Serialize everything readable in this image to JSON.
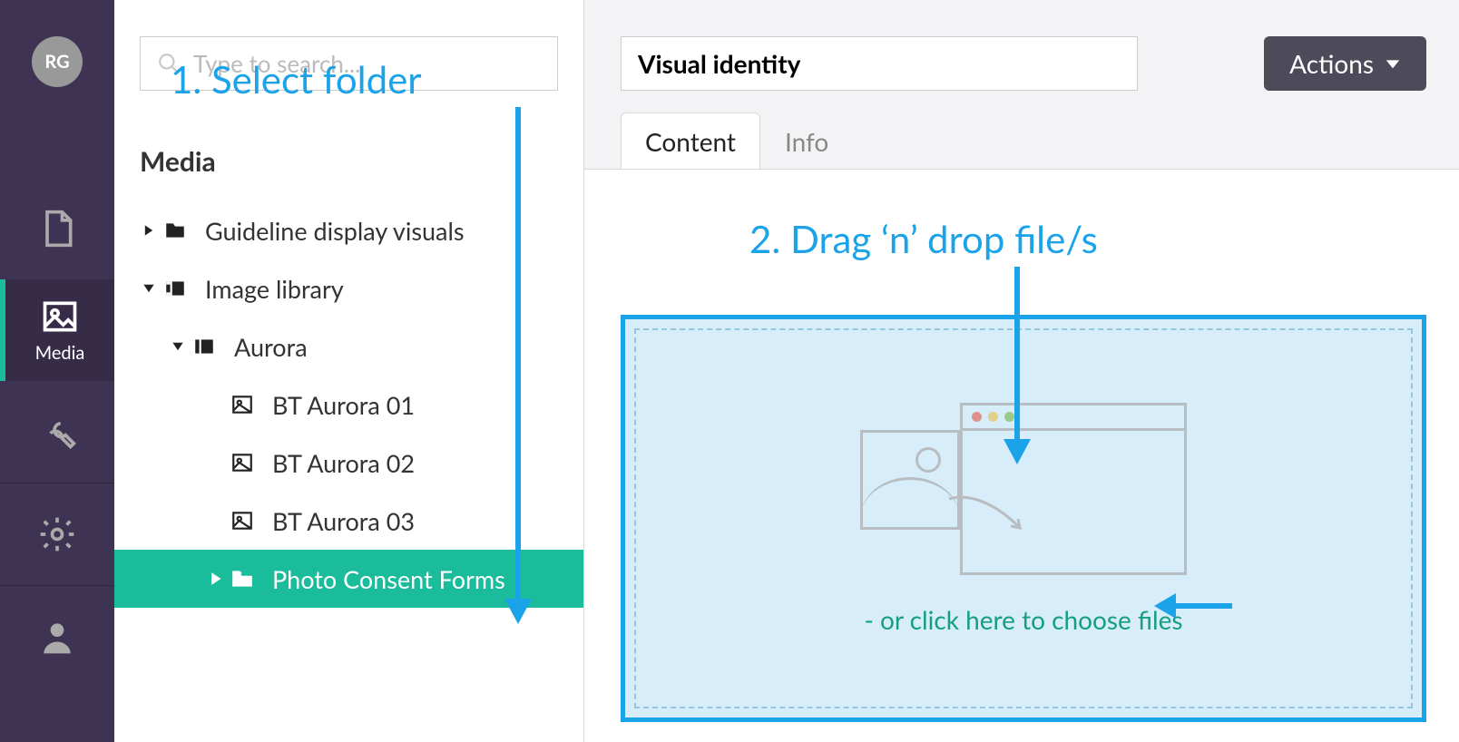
{
  "rail": {
    "avatar_initials": "RG",
    "items": [
      {
        "name": "content",
        "label": ""
      },
      {
        "name": "media",
        "label": "Media"
      },
      {
        "name": "settings-wrench",
        "label": ""
      },
      {
        "name": "settings-gear",
        "label": ""
      },
      {
        "name": "users",
        "label": ""
      }
    ],
    "active_index": 1
  },
  "tree": {
    "search_placeholder": "Type to search...",
    "section_title": "Media",
    "nodes": [
      {
        "label": "Guideline display visuals",
        "depth": 0,
        "icon": "folder",
        "expanded": false
      },
      {
        "label": "Image library",
        "depth": 0,
        "icon": "film",
        "expanded": true
      },
      {
        "label": "Aurora",
        "depth": 1,
        "icon": "film",
        "expanded": true
      },
      {
        "label": "BT Aurora 01",
        "depth": 2,
        "icon": "image",
        "leaf": true
      },
      {
        "label": "BT Aurora 02",
        "depth": 2,
        "icon": "image",
        "leaf": true
      },
      {
        "label": "BT Aurora 03",
        "depth": 2,
        "icon": "image",
        "leaf": true
      },
      {
        "label": "Photo Consent Forms",
        "depth": 3,
        "icon": "folder-open",
        "expanded": false,
        "selected": true
      }
    ]
  },
  "main": {
    "title_value": "Visual identity",
    "actions_label": "Actions",
    "tabs": [
      {
        "label": "Content",
        "active": true
      },
      {
        "label": "Info",
        "active": false
      }
    ],
    "dropzone": {
      "choose_text": "- or click here to choose files"
    }
  },
  "annotations": {
    "step1": "1. Select folder",
    "step2": "2. Drag ‘n’ drop file/s"
  },
  "illus_dots": [
    "#e06c5c",
    "#e7c559",
    "#7fbf5a"
  ]
}
